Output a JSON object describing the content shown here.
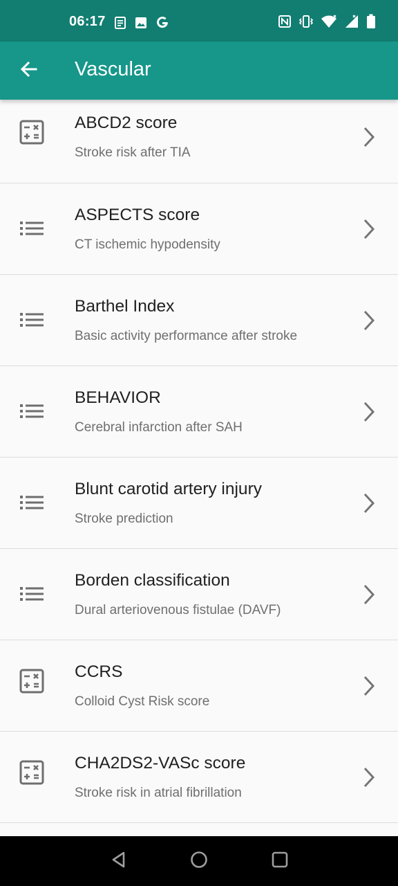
{
  "status_bar": {
    "time": "06:17",
    "left_icons": [
      "news-icon",
      "image-icon",
      "google-icon"
    ],
    "right_icons": [
      "nfc-icon",
      "vibrate-icon",
      "wifi-icon",
      "signal-icon",
      "battery-icon"
    ]
  },
  "app_bar": {
    "title": "Vascular",
    "back_icon": "arrow-left-icon",
    "color": "#16978a",
    "status_color": "#127e72"
  },
  "items": [
    {
      "title": "ABCD2 score",
      "subtitle": "Stroke risk after TIA",
      "icon": "calculator-icon"
    },
    {
      "title": "ASPECTS score",
      "subtitle": "CT ischemic hypodensity",
      "icon": "list-icon"
    },
    {
      "title": "Barthel Index",
      "subtitle": "Basic activity performance after stroke",
      "icon": "list-icon"
    },
    {
      "title": "BEHAVIOR",
      "subtitle": "Cerebral infarction after SAH",
      "icon": "list-icon"
    },
    {
      "title": "Blunt carotid artery injury",
      "subtitle": "Stroke prediction",
      "icon": "list-icon"
    },
    {
      "title": "Borden classification",
      "subtitle": "Dural arteriovenous fistulae (DAVF)",
      "icon": "list-icon"
    },
    {
      "title": "CCRS",
      "subtitle": "Colloid Cyst Risk score",
      "icon": "calculator-icon"
    },
    {
      "title": "CHA2DS2-VASc score",
      "subtitle": "Stroke risk in atrial fibrillation",
      "icon": "calculator-icon"
    }
  ],
  "nav_bar": {
    "buttons": [
      "back-triangle-icon",
      "home-circle-icon",
      "recents-square-icon"
    ]
  }
}
